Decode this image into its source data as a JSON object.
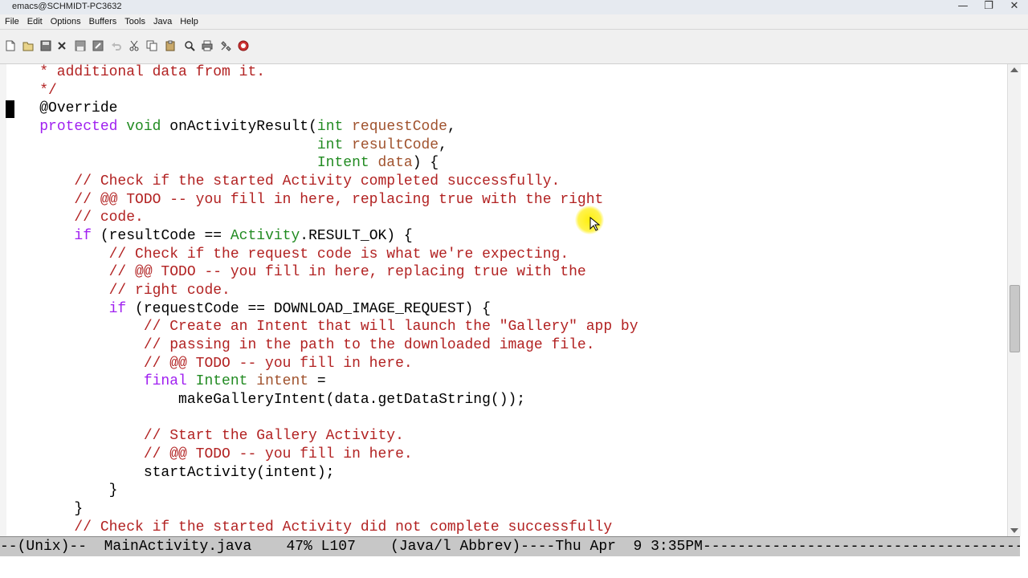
{
  "window": {
    "title": "emacs@SCHMIDT-PC3632",
    "minimize_glyph": "—",
    "maximize_glyph": "❐",
    "close_glyph": "✕"
  },
  "menubar": [
    "File",
    "Edit",
    "Options",
    "Buffers",
    "Tools",
    "Java",
    "Help"
  ],
  "toolbar": {
    "icons": [
      "new-file-icon",
      "open-folder-icon",
      "save-icon",
      "close-x-icon",
      "save-disk-icon",
      "save-as-icon",
      "undo-icon",
      "cut-icon",
      "copy-icon",
      "paste-icon",
      "search-icon",
      "print-icon",
      "preferences-icon",
      "help-icon"
    ]
  },
  "code": [
    [
      {
        "t": "    * additional data from it.",
        "c": "comment"
      }
    ],
    [
      {
        "t": "    */",
        "c": "comment"
      }
    ],
    [
      {
        "t": "    ",
        "c": "normal"
      },
      {
        "t": "@Override",
        "c": "annot"
      }
    ],
    [
      {
        "t": "    ",
        "c": "normal"
      },
      {
        "t": "protected",
        "c": "keyword"
      },
      {
        "t": " ",
        "c": "normal"
      },
      {
        "t": "void",
        "c": "type"
      },
      {
        "t": " onActivityResult(",
        "c": "normal"
      },
      {
        "t": "int",
        "c": "type"
      },
      {
        "t": " ",
        "c": "normal"
      },
      {
        "t": "requestCode",
        "c": "var"
      },
      {
        "t": ",",
        "c": "normal"
      }
    ],
    [
      {
        "t": "                                    ",
        "c": "normal"
      },
      {
        "t": "int",
        "c": "type"
      },
      {
        "t": " ",
        "c": "normal"
      },
      {
        "t": "resultCode",
        "c": "var"
      },
      {
        "t": ",",
        "c": "normal"
      }
    ],
    [
      {
        "t": "                                    ",
        "c": "normal"
      },
      {
        "t": "Intent",
        "c": "type"
      },
      {
        "t": " ",
        "c": "normal"
      },
      {
        "t": "data",
        "c": "var"
      },
      {
        "t": ") {",
        "c": "normal"
      }
    ],
    [
      {
        "t": "        // Check if the started Activity completed successfully.",
        "c": "comment"
      }
    ],
    [
      {
        "t": "        // @@ TODO -- you fill in here, replacing true with the right",
        "c": "comment"
      }
    ],
    [
      {
        "t": "        // code.",
        "c": "comment"
      }
    ],
    [
      {
        "t": "        ",
        "c": "normal"
      },
      {
        "t": "if",
        "c": "keyword"
      },
      {
        "t": " (resultCode == ",
        "c": "normal"
      },
      {
        "t": "Activity",
        "c": "class"
      },
      {
        "t": ".RESULT_OK) {",
        "c": "normal"
      }
    ],
    [
      {
        "t": "            // Check if the request code is what we're expecting.",
        "c": "comment"
      }
    ],
    [
      {
        "t": "            // @@ TODO -- you fill in here, replacing true with the",
        "c": "comment"
      }
    ],
    [
      {
        "t": "            // right code.",
        "c": "comment"
      }
    ],
    [
      {
        "t": "            ",
        "c": "normal"
      },
      {
        "t": "if",
        "c": "keyword"
      },
      {
        "t": " (requestCode == DOWNLOAD_IMAGE_REQUEST) {",
        "c": "normal"
      }
    ],
    [
      {
        "t": "                // Create an Intent that will launch the \"Gallery\" app by",
        "c": "comment"
      }
    ],
    [
      {
        "t": "                // passing in the path to the downloaded image file.",
        "c": "comment"
      }
    ],
    [
      {
        "t": "                // @@ TODO -- you fill in here.",
        "c": "comment"
      }
    ],
    [
      {
        "t": "                ",
        "c": "normal"
      },
      {
        "t": "final",
        "c": "keyword"
      },
      {
        "t": " ",
        "c": "normal"
      },
      {
        "t": "Intent",
        "c": "type"
      },
      {
        "t": " ",
        "c": "normal"
      },
      {
        "t": "intent",
        "c": "var"
      },
      {
        "t": " =",
        "c": "normal"
      }
    ],
    [
      {
        "t": "                    makeGalleryIntent(data.getDataString());",
        "c": "normal"
      }
    ],
    [
      {
        "t": "",
        "c": "normal"
      }
    ],
    [
      {
        "t": "                // Start the Gallery Activity.",
        "c": "comment"
      }
    ],
    [
      {
        "t": "                // @@ TODO -- you fill in here.",
        "c": "comment"
      }
    ],
    [
      {
        "t": "                startActivity(intent);",
        "c": "normal"
      }
    ],
    [
      {
        "t": "            }",
        "c": "normal"
      }
    ],
    [
      {
        "t": "        }",
        "c": "normal"
      }
    ],
    [
      {
        "t": "        // Check if the started Activity did not complete successfully",
        "c": "comment"
      }
    ]
  ],
  "modeline": {
    "text": "--(Unix)--  MainActivity.java    47% L107    (Java/l Abbrev)----Thu Apr  9 3:35PM------------------------------------------------------------------"
  }
}
